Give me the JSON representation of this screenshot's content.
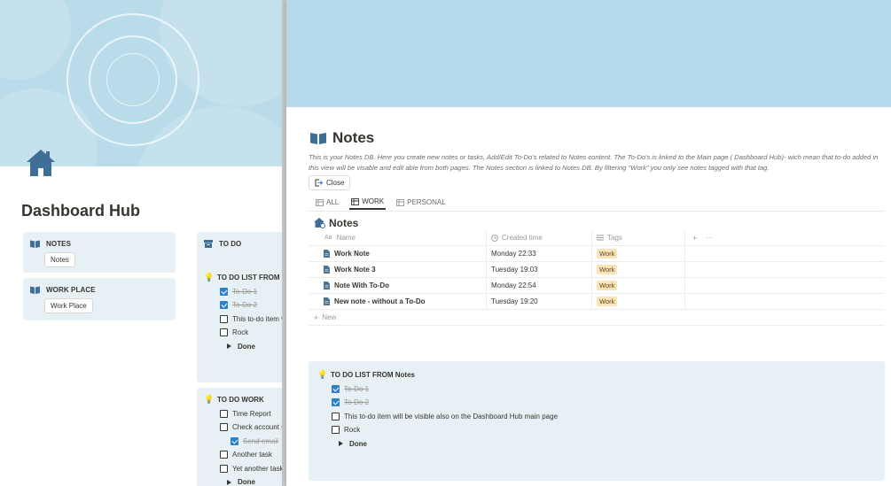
{
  "left": {
    "title": "Dashboard Hub",
    "notes_card": {
      "heading": "NOTES",
      "chip": "Notes"
    },
    "work_card": {
      "heading": "WORK PLACE",
      "chip": "Work Place"
    },
    "todo_header": "TO DO",
    "todo_list_header": "TO DO LIST FROM N",
    "todo_items": [
      {
        "label": "To-Do 1",
        "checked": true
      },
      {
        "label": "To-Do 2",
        "checked": true
      },
      {
        "label": "This to-do item v",
        "checked": false
      },
      {
        "label": "Rock",
        "checked": false
      }
    ],
    "done_label": "Done",
    "todo_work_header": "TO DO WORK",
    "work_items": [
      {
        "label": "Time Report",
        "checked": false,
        "indent": false
      },
      {
        "label": "Check account s",
        "checked": false,
        "indent": false
      },
      {
        "label": "Send email",
        "checked": true,
        "indent": true
      },
      {
        "label": "Another task",
        "checked": false,
        "indent": false
      },
      {
        "label": "Yet another task",
        "checked": false,
        "indent": false
      }
    ],
    "work_done_label": "Done"
  },
  "peek": {
    "title": "Notes",
    "description": "This is your Notes DB. Here you create new notes or tasks, Add/Edit To-Do's related to Notes content. The To-Do's is linked to the Main page ( Dashboard Hub)- wich mean that to-do added in this view will be visable and edit able from both pages.  The Notes section is linked to Notes DB. By filtering \"Work\" you only see notes tagged with that tag.",
    "close_label": "Close",
    "tabs": [
      {
        "label": "ALL",
        "active": false
      },
      {
        "label": "WORK",
        "active": true
      },
      {
        "label": "PERSONAL",
        "active": false
      }
    ],
    "db_title": "Notes",
    "columns": {
      "name": "Name",
      "created": "Created time",
      "tags": "Tags",
      "add": "+",
      "more": "···"
    },
    "column_icons": {
      "name": "Aa",
      "created": "clock-icon",
      "tags": "list-icon"
    },
    "rows": [
      {
        "name": "Work Note",
        "created": "Monday 22:33",
        "tag": "Work"
      },
      {
        "name": "Work Note 3",
        "created": "Tuesday 19:03",
        "tag": "Work"
      },
      {
        "name": "Note With To-Do",
        "created": "Monday 22:54",
        "tag": "Work"
      },
      {
        "name": "New note - without a To-Do",
        "created": "Tuesday 19:20",
        "tag": "Work"
      }
    ],
    "new_label": "New",
    "todo_list_header": "TO DO LIST FROM Notes",
    "todo_items": [
      {
        "label": "To-Do 1",
        "checked": true
      },
      {
        "label": "To-Do 2",
        "checked": true
      },
      {
        "label": "This to-do item will be visible also on the Dashboard Hub main page",
        "checked": false
      },
      {
        "label": "Rock",
        "checked": false
      }
    ],
    "done_label": "Done"
  },
  "colors": {
    "cover": "#b3d9ea",
    "callout": "#e7f0f5",
    "checkbox": "#2f80c8",
    "tag": "#fae3b8",
    "icon_blue": "#4a7496"
  }
}
